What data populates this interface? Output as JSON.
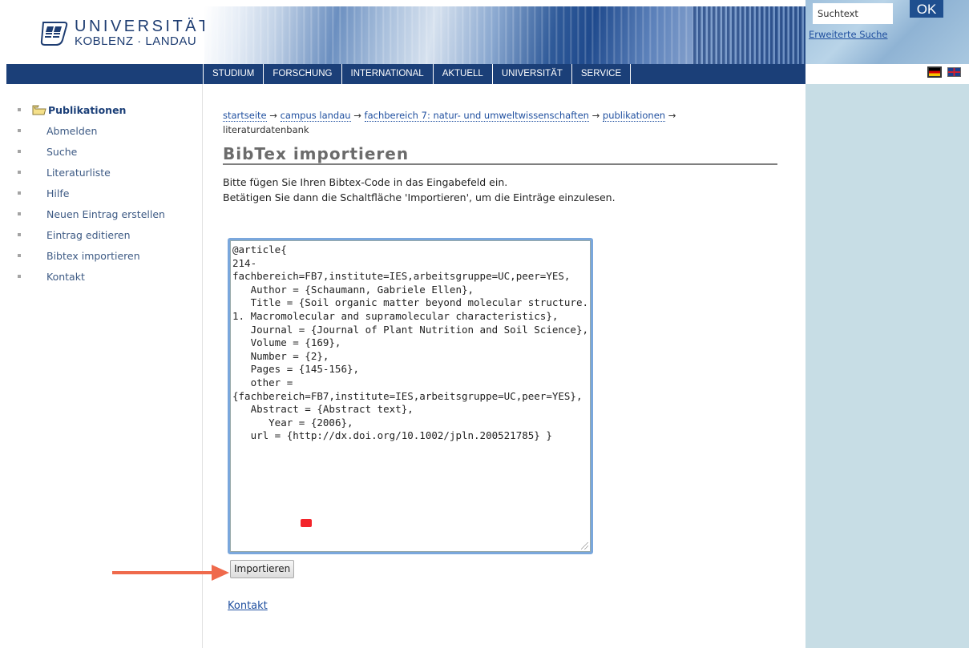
{
  "header": {
    "logo_line1": "UNIVERSITÄT",
    "logo_line2": "KOBLENZ · LANDAU"
  },
  "nav": {
    "items": [
      "STUDIUM",
      "FORSCHUNG",
      "INTERNATIONAL",
      "AKTUELL",
      "UNIVERSITÄT",
      "SERVICE"
    ]
  },
  "search": {
    "value": "Suchtext",
    "button_label": "OK",
    "advanced_link": "Erweiterte Suche"
  },
  "sidebar": {
    "items": [
      {
        "label": "Publikationen",
        "active": true
      },
      {
        "label": "Abmelden"
      },
      {
        "label": "Suche"
      },
      {
        "label": "Literaturliste"
      },
      {
        "label": "Hilfe"
      },
      {
        "label": "Neuen Eintrag erstellen"
      },
      {
        "label": "Eintrag editieren"
      },
      {
        "label": "Bibtex importieren"
      },
      {
        "label": "Kontakt"
      }
    ]
  },
  "breadcrumb": {
    "links": [
      "startseite",
      "campus landau",
      "fachbereich 7: natur- und umweltwissenschaften",
      "publikationen"
    ],
    "separator": "→",
    "current": "literaturdatenbank"
  },
  "main": {
    "title": "BibTex importieren",
    "intro_line1": "Bitte fügen Sie Ihren Bibtex-Code in das Eingabefeld ein.",
    "intro_line2": "Betätigen Sie dann die Schaltfläche 'Importieren', um die Einträge einzulesen.",
    "bibtex_text": "@article{\n214-\nfachbereich=FB7,institute=IES,arbeitsgruppe=UC,peer=YES,\n   Author = {Schaumann, Gabriele Ellen},\n   Title = {Soil organic matter beyond molecular structure. 1. Macromolecular and supramolecular characteristics},\n   Journal = {Journal of Plant Nutrition and Soil Science},\n   Volume = {169},\n   Number = {2},\n   Pages = {145-156},\n   other =\n{fachbereich=FB7,institute=IES,arbeitsgruppe=UC,peer=YES},\n   Abstract = {Abstract text},\n      Year = {2006},\n   url = {http://dx.doi.org/10.1002/jpln.200521785} }",
    "import_button": "Importieren",
    "contact_link": "Kontakt"
  },
  "colors": {
    "nav_bar": "#1b3f78",
    "right_panel": "#c7dde5",
    "link": "#1f4f9f",
    "annotation_arrow": "#ef6a4c"
  },
  "icons": {
    "folder": "folder-icon",
    "flag_de": "german-flag-icon",
    "flag_en": "uk-flag-icon"
  }
}
